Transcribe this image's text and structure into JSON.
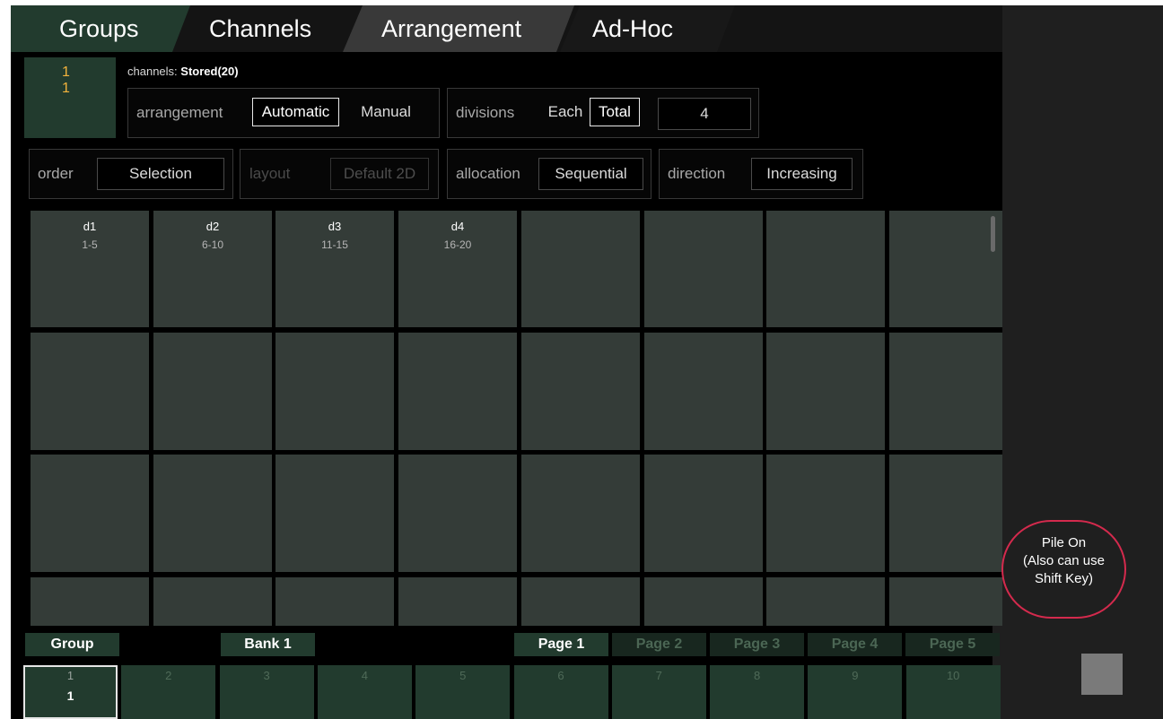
{
  "tabs": {
    "groups": "Groups",
    "channels": "Channels",
    "arrangement": "Arrangement",
    "adhoc": "Ad-Hoc"
  },
  "selection": {
    "line1": "1",
    "line2": "1"
  },
  "channels_info": {
    "label": "channels:",
    "value": "Stored(20)"
  },
  "arrangement": {
    "label": "arrangement",
    "automatic": "Automatic",
    "manual": "Manual"
  },
  "divisions": {
    "label": "divisions",
    "each": "Each",
    "total": "Total",
    "value": "4"
  },
  "order": {
    "label": "order",
    "value": "Selection"
  },
  "layout": {
    "label": "layout",
    "value": "Default 2D"
  },
  "allocation": {
    "label": "allocation",
    "value": "Sequential"
  },
  "direction": {
    "label": "direction",
    "value": "Increasing"
  },
  "divisions_list": [
    {
      "name": "d1",
      "range": "1-5"
    },
    {
      "name": "d2",
      "range": "6-10"
    },
    {
      "name": "d3",
      "range": "11-15"
    },
    {
      "name": "d4",
      "range": "16-20"
    }
  ],
  "pile_on": {
    "line1": "Pile On",
    "line2": "(Also can use",
    "line3": "Shift Key)"
  },
  "bottom": {
    "group_label": "Group",
    "bank_label": "Bank 1",
    "pages": [
      "Page 1",
      "Page 2",
      "Page 3",
      "Page 4",
      "Page 5"
    ],
    "cells": [
      "1",
      "2",
      "3",
      "4",
      "5",
      "6",
      "7",
      "8",
      "9",
      "10"
    ],
    "selected_sub": "1"
  },
  "colors": {
    "selected_bg": "#223b2e",
    "cell_bg": "#343c38",
    "accent_yellow": "#f2b33d",
    "pile_border": "#d42a4d"
  }
}
